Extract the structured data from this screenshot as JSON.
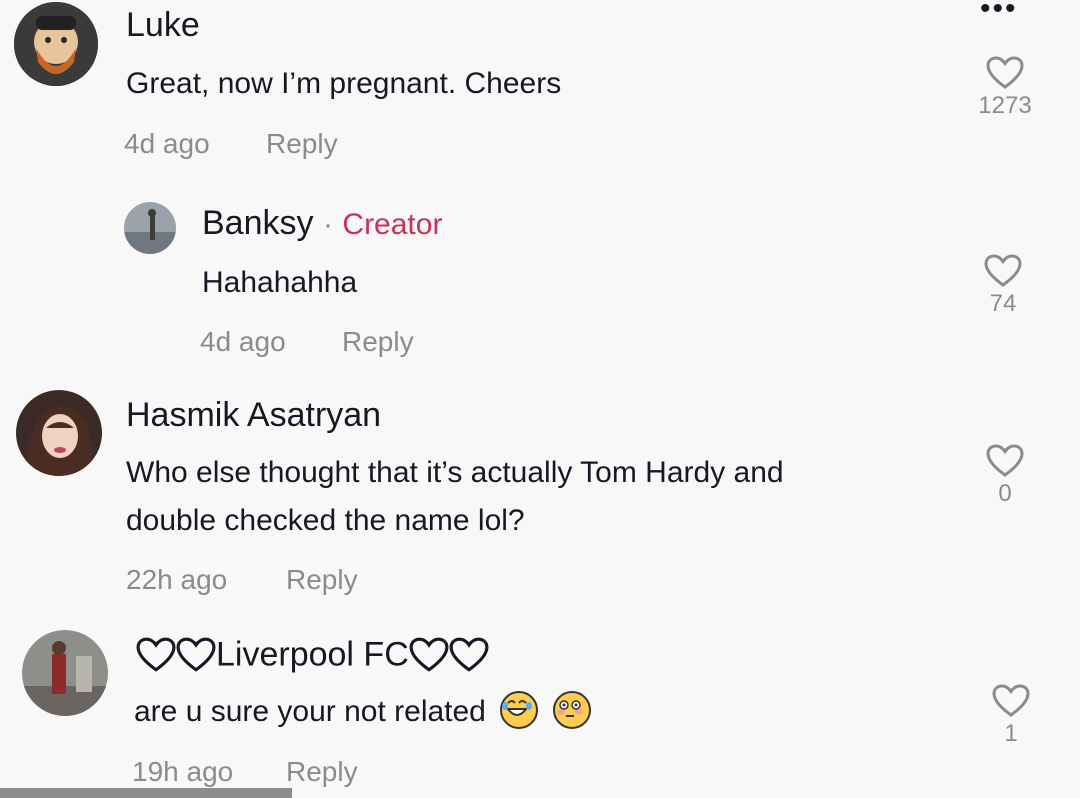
{
  "comments": [
    {
      "username": "Luke",
      "text": "Great, now I’m pregnant. Cheers",
      "time": "4d ago",
      "reply_label": "Reply",
      "likes": "1273"
    },
    {
      "username": "Banksy",
      "separator": "·",
      "badge": "Creator",
      "text": "Hahahahha",
      "time": "4d ago",
      "reply_label": "Reply",
      "likes": "74"
    },
    {
      "username": "Hasmik Asatryan",
      "text_line1": "Who else thought that it’s actually Tom Hardy and",
      "text_line2": "double checked the name lol?",
      "time": "22h ago",
      "reply_label": "Reply",
      "likes": "0"
    },
    {
      "username": "Liverpool FC",
      "text": "are u sure your not related",
      "emojis": [
        "laughing-crying-emoji",
        "flushed-emoji"
      ],
      "time": "19h ago",
      "reply_label": "Reply",
      "likes": "1"
    }
  ],
  "more_label": "•••",
  "colors": {
    "creator": "#c8325a",
    "meta": "#8a8b91",
    "background": "#f8f8f8"
  }
}
